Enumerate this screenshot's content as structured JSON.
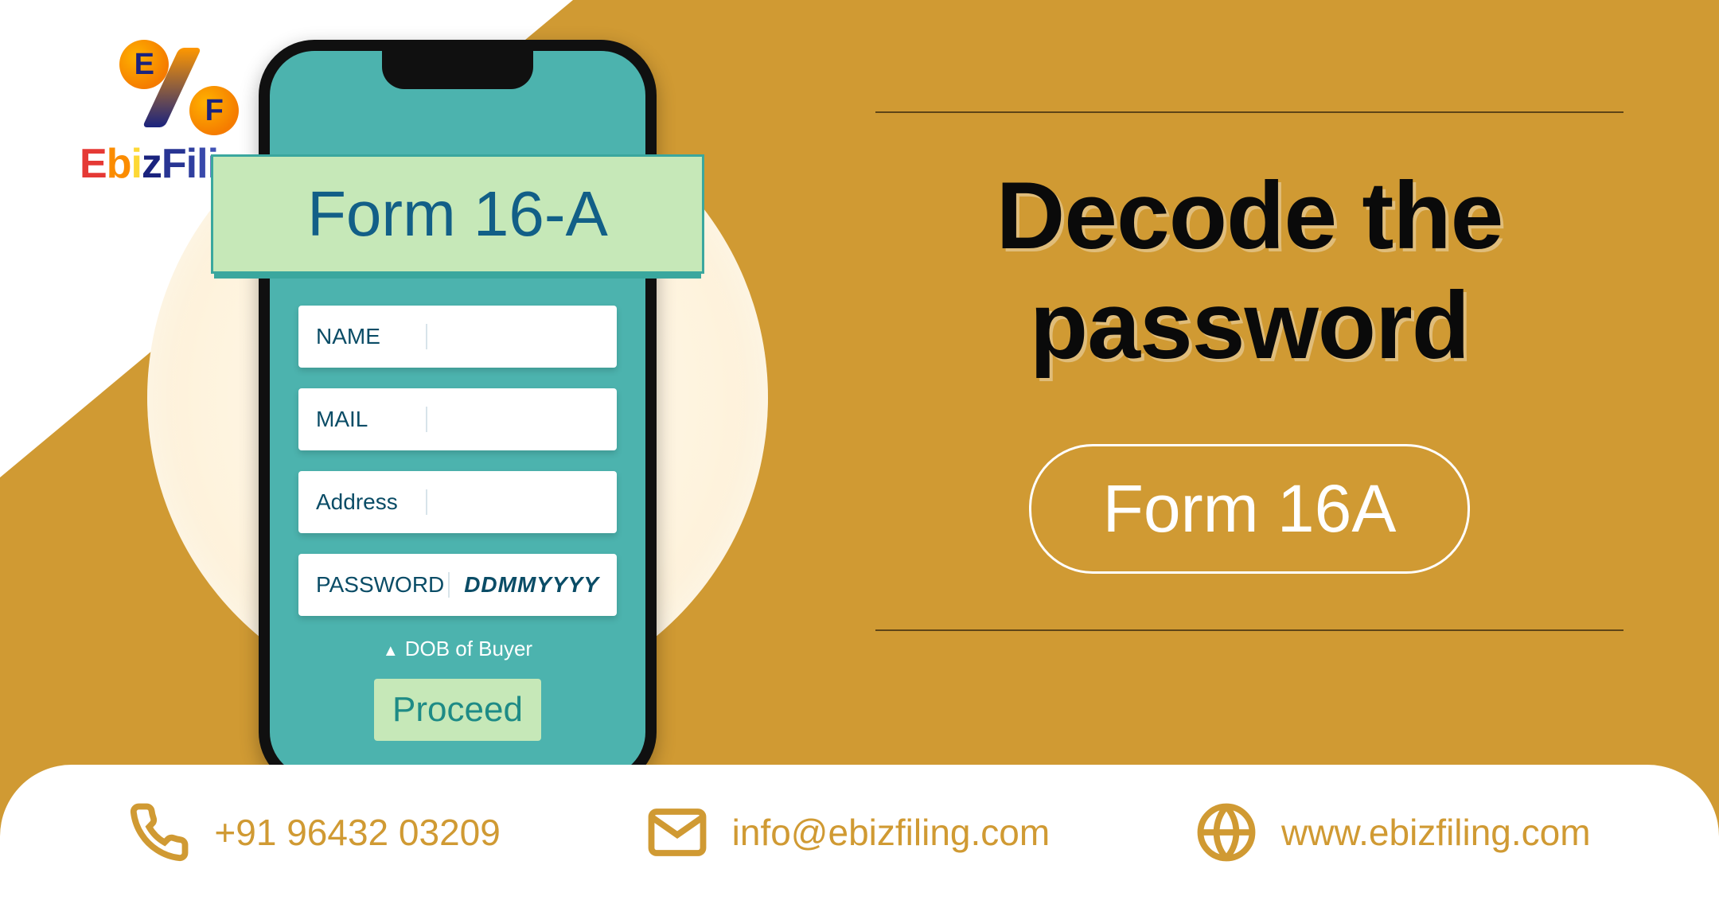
{
  "brand": {
    "name": "EbizFiling",
    "tm": "™"
  },
  "phone": {
    "banner": "Form 16-A",
    "fields": {
      "name_label": "NAME",
      "mail_label": "MAIL",
      "address_label": "Address",
      "password_label": "PASSWORD",
      "password_value": "DDMMYYYY"
    },
    "hint": "DOB of Buyer",
    "proceed": "Proceed"
  },
  "headline": {
    "line1": "Decode the",
    "line2": "password"
  },
  "pill": "Form 16A",
  "footer": {
    "phone": "+91 96432 03209",
    "email": "info@ebizfiling.com",
    "website": "www.ebizfiling.com"
  },
  "colors": {
    "bg": "#D09A33",
    "teal": "#4CB3AE",
    "mint": "#C6E8B8"
  }
}
